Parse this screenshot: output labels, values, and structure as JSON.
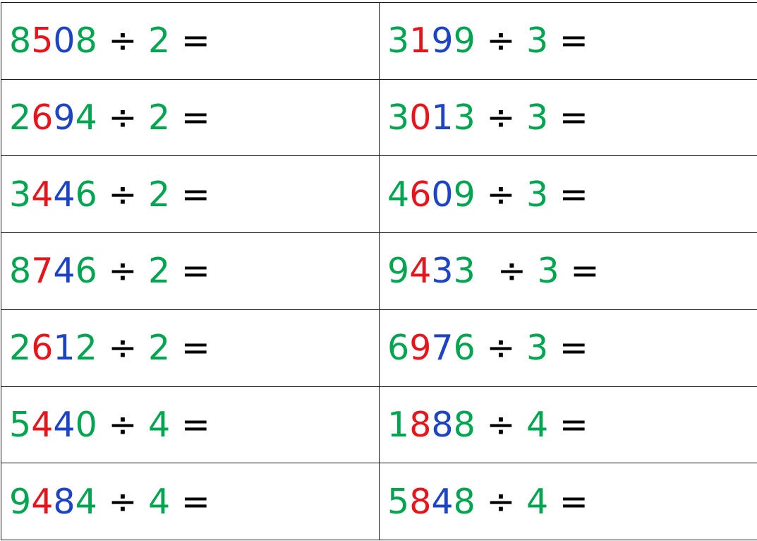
{
  "colors": {
    "thousands": "#00a550",
    "hundreds": "#e8141c",
    "tens": "#1c44c4",
    "ones": "#00a550",
    "divisor": "#00a550",
    "operator": "#000000"
  },
  "symbols": {
    "divide": "÷",
    "equals": "="
  },
  "rows": [
    {
      "left": {
        "th": "8",
        "h": "5",
        "t": "0",
        "o": "8",
        "divisor": "2",
        "gap": " "
      },
      "right": {
        "th": "3",
        "h": "1",
        "t": "9",
        "o": "9",
        "divisor": "3",
        "gap": " "
      }
    },
    {
      "left": {
        "th": "2",
        "h": "6",
        "t": "9",
        "o": "4",
        "divisor": "2",
        "gap": " "
      },
      "right": {
        "th": "3",
        "h": "0",
        "t": "1",
        "o": "3",
        "divisor": "3",
        "gap": " "
      }
    },
    {
      "left": {
        "th": "3",
        "h": "4",
        "t": "4",
        "o": "6",
        "divisor": "2",
        "gap": " "
      },
      "right": {
        "th": "4",
        "h": "6",
        "t": "0",
        "o": "9",
        "divisor": "3",
        "gap": " "
      }
    },
    {
      "left": {
        "th": "8",
        "h": "7",
        "t": "4",
        "o": "6",
        "divisor": "2",
        "gap": " "
      },
      "right": {
        "th": "9",
        "h": "4",
        "t": "3",
        "o": "3",
        "divisor": "3",
        "gap": "  "
      }
    },
    {
      "left": {
        "th": "2",
        "h": "6",
        "t": "1",
        "o": "2",
        "divisor": "2",
        "gap": " "
      },
      "right": {
        "th": "6",
        "h": "9",
        "t": "7",
        "o": "6",
        "divisor": "3",
        "gap": " "
      }
    },
    {
      "left": {
        "th": "5",
        "h": "4",
        "t": "4",
        "o": "0",
        "divisor": "4",
        "gap": " "
      },
      "right": {
        "th": "1",
        "h": "8",
        "t": "8",
        "o": "8",
        "divisor": "4",
        "gap": " "
      }
    },
    {
      "left": {
        "th": "9",
        "h": "4",
        "t": "8",
        "o": "4",
        "divisor": "4",
        "gap": " "
      },
      "right": {
        "th": "5",
        "h": "8",
        "t": "4",
        "o": "8",
        "divisor": "4",
        "gap": " "
      }
    }
  ]
}
